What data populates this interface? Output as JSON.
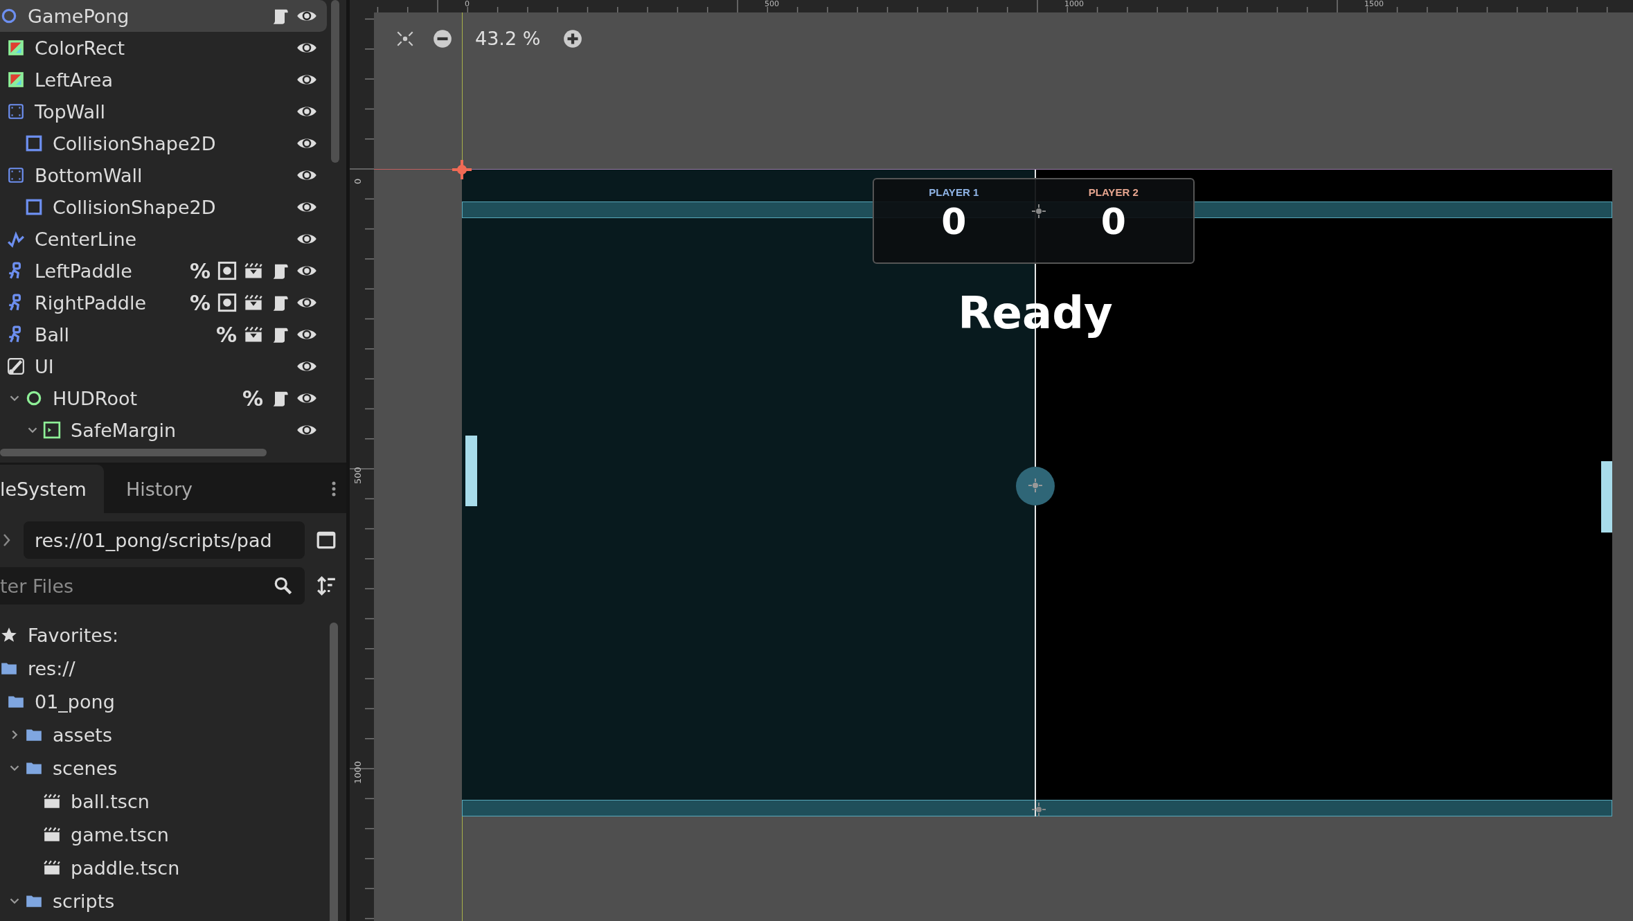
{
  "scene_tree": {
    "items": [
      {
        "name": "GamePong",
        "kind": "node2d",
        "selected": true,
        "visible": true,
        "badges": [
          {
            "kind": "script"
          }
        ],
        "children": [
          {
            "name": "ColorRect",
            "kind": "colorrect",
            "selected": false,
            "visible": true
          },
          {
            "name": "LeftArea",
            "kind": "colorrect",
            "selected": false,
            "visible": true
          },
          {
            "name": "TopWall",
            "kind": "body",
            "selected": false,
            "visible": true,
            "children": [
              {
                "name": "CollisionShape2D",
                "kind": "shape",
                "selected": false,
                "visible": true
              }
            ]
          },
          {
            "name": "BottomWall",
            "kind": "body",
            "selected": false,
            "visible": true,
            "children": [
              {
                "name": "CollisionShape2D",
                "kind": "shape",
                "selected": false,
                "visible": true
              }
            ]
          },
          {
            "name": "CenterLine",
            "kind": "line",
            "selected": false,
            "visible": true
          },
          {
            "name": "LeftPaddle",
            "kind": "character",
            "selected": false,
            "visible": true,
            "badges": [
              {
                "kind": "unique",
                "glyph": "%"
              },
              {
                "kind": "instance"
              },
              {
                "kind": "scene"
              },
              {
                "kind": "script"
              }
            ]
          },
          {
            "name": "RightPaddle",
            "kind": "character",
            "selected": false,
            "visible": true,
            "badges": [
              {
                "kind": "unique",
                "glyph": "%"
              },
              {
                "kind": "instance"
              },
              {
                "kind": "scene"
              },
              {
                "kind": "script"
              }
            ]
          },
          {
            "name": "Ball",
            "kind": "character",
            "selected": false,
            "visible": true,
            "badges": [
              {
                "kind": "unique",
                "glyph": "%"
              },
              {
                "kind": "scene"
              },
              {
                "kind": "script"
              }
            ]
          },
          {
            "name": "UI",
            "kind": "canvas",
            "selected": false,
            "visible": true,
            "children": [
              {
                "name": "HUDRoot",
                "kind": "control",
                "selected": false,
                "visible": true,
                "expanded": true,
                "badges": [
                  {
                    "kind": "unique",
                    "glyph": "%"
                  },
                  {
                    "kind": "script"
                  }
                ],
                "children": [
                  {
                    "name": "SafeMargin",
                    "kind": "margin",
                    "selected": false,
                    "visible": true,
                    "expanded": true
                  }
                ]
              }
            ]
          }
        ]
      }
    ]
  },
  "dock": {
    "tabs": [
      {
        "label": "leSystem",
        "selected": true
      },
      {
        "label": "History",
        "selected": false
      }
    ],
    "path": "res://01_pong/scripts/pad",
    "filter": {
      "placeholder": "ter Files"
    },
    "files": [
      {
        "name": "Favorites:",
        "kind": "star"
      },
      {
        "name": "res://",
        "kind": "folder",
        "children": [
          {
            "name": "01_pong",
            "kind": "folder",
            "children": [
              {
                "name": "assets",
                "kind": "folder",
                "expanded": false
              },
              {
                "name": "scenes",
                "kind": "folder",
                "expanded": true,
                "children": [
                  {
                    "name": "ball.tscn",
                    "kind": "scene"
                  },
                  {
                    "name": "game.tscn",
                    "kind": "scene"
                  },
                  {
                    "name": "paddle.tscn",
                    "kind": "scene"
                  }
                ]
              },
              {
                "name": "scripts",
                "kind": "folder",
                "expanded": true
              }
            ]
          }
        ]
      }
    ]
  },
  "viewport": {
    "rulers": {
      "horizontal": [
        "0",
        "500",
        "1000",
        "1500"
      ],
      "vertical": [
        "0",
        "500",
        "1000"
      ]
    },
    "zoom": "43.2 %",
    "game": {
      "scores": [
        {
          "label": "PLAYER 1",
          "score": "0",
          "color": "#8fb4e6"
        },
        {
          "label": "PLAYER 2",
          "score": "0",
          "color": "#e6a58f"
        }
      ],
      "message": "Ready"
    }
  }
}
